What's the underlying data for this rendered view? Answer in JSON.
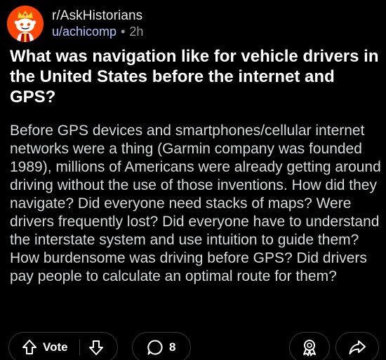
{
  "post": {
    "subreddit": "r/AskHistorians",
    "author": "u/achicomp",
    "separator": "•",
    "age": "2h",
    "title": "What was navigation like for vehicle drivers in the United States before the internet and GPS?",
    "body": "Before GPS devices and smartphones/cellular internet networks were a thing (Garmin company was founded 1989), millions of Americans were already getting around driving without the use of those inventions. How did they navigate? Did everyone need stacks of maps? Were drivers frequently lost? Did everyone have to understand the interstate system and use intuition to guide them? How burdensome was driving before GPS? Did drivers pay people to calculate an optimal route for them?"
  },
  "actions": {
    "vote_label": "Vote",
    "comment_count": "8",
    "upvote_icon": "arrow-up-icon",
    "downvote_icon": "arrow-down-icon",
    "comment_icon": "comment-bubble-icon",
    "award_icon": "award-icon",
    "share_icon": "share-icon"
  },
  "colors": {
    "background": "#000000",
    "avatar_bg": "#ff4500",
    "username": "#b3c2ff",
    "muted": "#9a9a9a",
    "pill_border": "#3a3a3a"
  }
}
